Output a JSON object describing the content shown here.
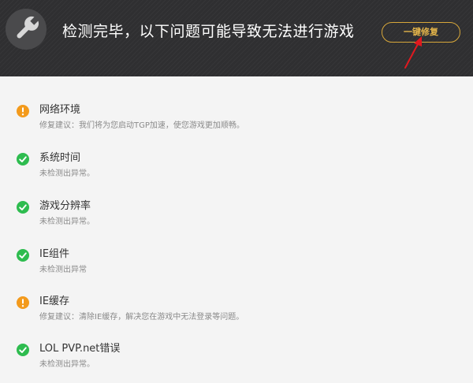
{
  "header": {
    "title": "检测完毕，以下问题可能导致无法进行游戏",
    "fix_button_label": "一键修复"
  },
  "colors": {
    "header_bg": "#2f2f31",
    "accent_gold": "#d7a73a",
    "ok_green": "#2ebc4f",
    "warn_orange": "#f39a1c",
    "arrow_red": "#e0191f"
  },
  "items": [
    {
      "status": "warning",
      "icon": "exclamation-icon",
      "title": "网络环境",
      "desc": "修复建议：我们将为您启动TGP加速，使您游戏更加顺畅。"
    },
    {
      "status": "ok",
      "icon": "checkmark-icon",
      "title": "系统时间",
      "desc": "未检测出异常。"
    },
    {
      "status": "ok",
      "icon": "checkmark-icon",
      "title": "游戏分辨率",
      "desc": "未检测出异常。"
    },
    {
      "status": "ok",
      "icon": "checkmark-icon",
      "title": "IE组件",
      "desc": "未检测出异常"
    },
    {
      "status": "warning",
      "icon": "exclamation-icon",
      "title": "IE缓存",
      "desc": "修复建议：清除IE缓存，解决您在游戏中无法登录等问题。"
    },
    {
      "status": "ok",
      "icon": "checkmark-icon",
      "title": "LOL PVP.net错误",
      "desc": "未检测出异常。"
    }
  ]
}
